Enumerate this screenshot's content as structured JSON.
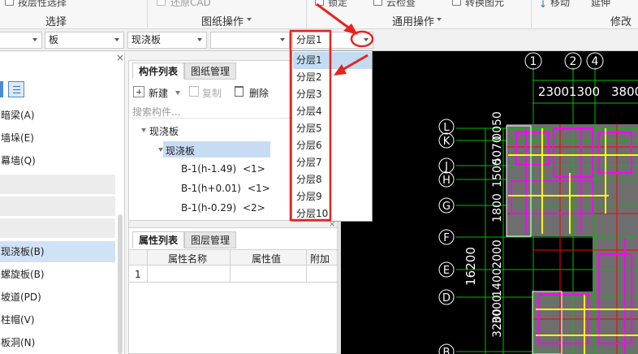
{
  "ribbon": {
    "select_item": "按层性选择",
    "select_group": "选择",
    "cad_item": "还原CAD",
    "drawing_group": "图纸操作",
    "lock_item": "锁定",
    "cloud_check": "云检查",
    "convert_item": "转换图元",
    "common_group": "通用操作",
    "move_item": "移动",
    "extend_item": "延伸",
    "modify_group": "修改"
  },
  "selectors": {
    "combo1": "",
    "combo2": "板",
    "combo3": "现浇板",
    "combo4": "",
    "layer_combo": "分层1"
  },
  "left_panel": {
    "items": [
      "暗梁(A)",
      "墙垛(E)",
      "幕墙(Q)",
      "现浇板(B)",
      "螺旋板(B)",
      "坡道(PD)",
      "柱帽(V)",
      "板洞(N)"
    ]
  },
  "component_panel": {
    "tabs": [
      "构件列表",
      "图纸管理"
    ],
    "new_label": "新建",
    "copy_label": "复制",
    "delete_label": "删除",
    "search_placeholder": "搜索构件...",
    "tree_root": "现浇板",
    "tree_child": "现浇板",
    "rows": [
      {
        "name": "B-1(h-1.49)",
        "count": "<1>"
      },
      {
        "name": "B-1(h+0.01)",
        "count": "<1>"
      },
      {
        "name": "B-1(h-0.29)",
        "count": "<2>"
      }
    ]
  },
  "property_panel": {
    "tabs": [
      "属性列表",
      "图层管理"
    ],
    "headers": [
      "属性名称",
      "属性值",
      "附加"
    ],
    "row_index": "1"
  },
  "layer_dropdown": {
    "options": [
      "分层1",
      "分层2",
      "分层3",
      "分层4",
      "分层5",
      "分层6",
      "分层7",
      "分层8",
      "分层9",
      "分层10"
    ],
    "selected_index": 0
  },
  "cad": {
    "column_axes": [
      "1",
      "2",
      "4"
    ],
    "top_dims": [
      "2300",
      "1300",
      "3800"
    ],
    "row_axes": [
      "L",
      "K",
      "J",
      "H",
      "G",
      "F",
      "E",
      "D",
      "B"
    ],
    "left_dims_top": [
      "5070",
      "0050",
      "1500",
      "1800",
      "2000",
      "1400",
      "3000",
      "3200"
    ],
    "total_dim": "16200",
    "colors": {
      "background": "#000000",
      "grid": "#00c000",
      "magenta": "#ff00ff",
      "yellow": "#ffff00",
      "slab": "#6e6e6e",
      "red": "#ff0000"
    }
  },
  "annotation_color": "#e8231f",
  "close_symbol": "×"
}
